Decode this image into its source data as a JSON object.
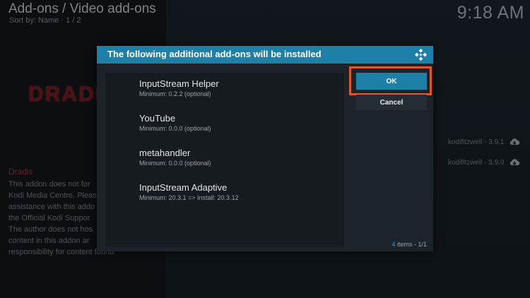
{
  "header": {
    "title": "Add-ons / Video add-ons",
    "sort": "Sort by: Name · 1 / 2",
    "clock": "9:18 AM"
  },
  "addon": {
    "logo_text": "DRADIS",
    "name": "Dradis",
    "description_lines": [
      "This addon does not for",
      "Kodi Media Centre. Pleas",
      "assistance with this addo",
      "the Official Kodi Suppor",
      "The author does not hos",
      "content in this addon ar",
      "responsibility for content found"
    ]
  },
  "versions": [
    {
      "label": "kodifitzwell - 3.9.1",
      "icon": "cloud-download-icon"
    },
    {
      "label": "kodifitzwell - 3.9.0",
      "icon": "cloud-download-icon"
    }
  ],
  "dialog": {
    "title": "The following additional add-ons will be installed",
    "icon": "kodi-icon",
    "items": [
      {
        "name": "InputStream Helper",
        "info": "Minimum: 0.2.2 (optional)"
      },
      {
        "name": "YouTube",
        "info": "Minimum: 0.0.0 (optional)"
      },
      {
        "name": "metahandler",
        "info": "Minimum: 0.0.0 (optional)"
      },
      {
        "name": "InputStream Adaptive",
        "info": "Minimum: 20.3.1 => Install: 20.3.12"
      }
    ],
    "ok_label": "OK",
    "cancel_label": "Cancel",
    "count_num": "4",
    "count_text": " items - 1/1"
  },
  "colors": {
    "accent": "#1e80a6",
    "highlight": "#e2562c",
    "addon_red": "#c7333a"
  }
}
